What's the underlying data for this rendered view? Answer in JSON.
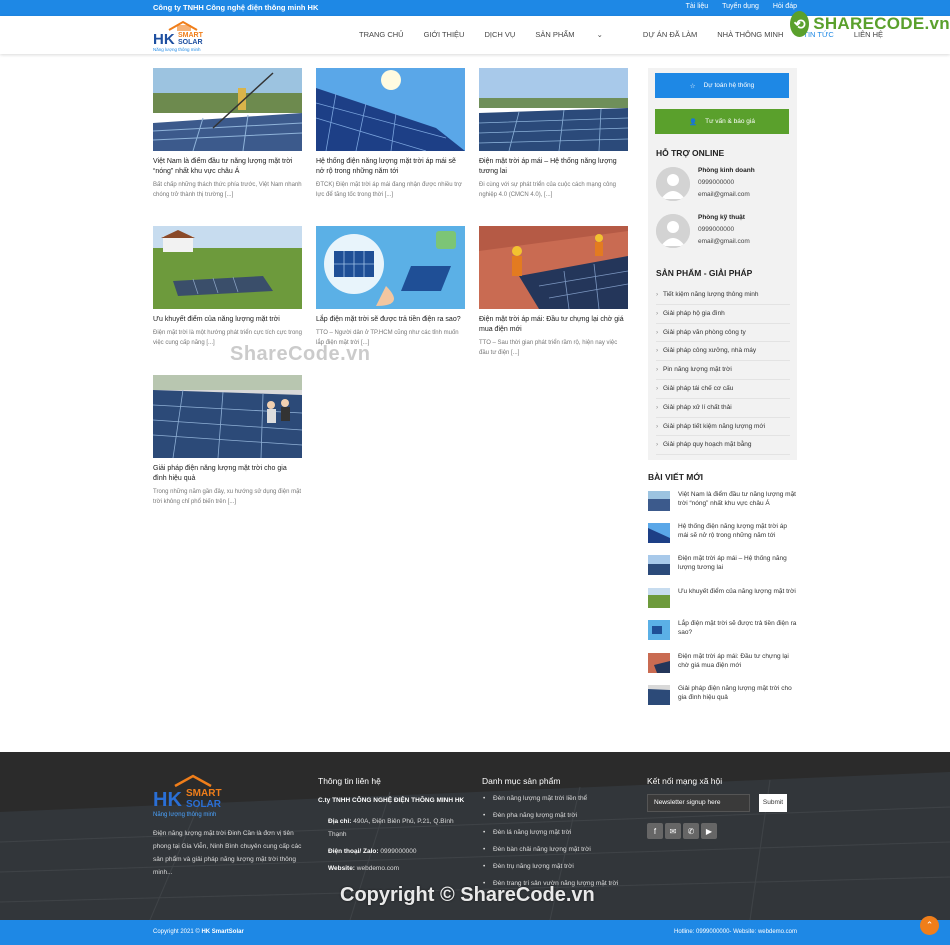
{
  "topbar": {
    "company": "Công ty TNHH Công nghệ điện thông minh HK",
    "links": [
      "Tài liệu",
      "Tuyển dụng",
      "Hỏi đáp"
    ]
  },
  "logo": {
    "main": "HK",
    "sub1": "SMART",
    "sub2": "SOLAR",
    "tagline": "Năng lượng thông minh"
  },
  "nav": [
    "TRANG CHỦ",
    "GIỚI THIỆU",
    "DỊCH VỤ",
    "SẢN PHẨM",
    "DỰ ÁN ĐÃ LÀM",
    "NHÀ THÔNG MINH",
    "TIN TỨC",
    "LIÊN HỆ"
  ],
  "watermark": {
    "logo_text": "SHARECODE.vn",
    "mid": "ShareCode.vn",
    "bottom": "Copyright © ShareCode.vn"
  },
  "posts": [
    {
      "title": "Việt Nam là điểm đầu tư năng lượng mặt trời “nóng” nhất khu vực châu Á",
      "excerpt": "Bất chấp những thách thức phía trước, Việt Nam nhanh chóng trở thành thị trường [...]"
    },
    {
      "title": "Hệ thống điện năng lượng mặt trời áp mái sẽ nở rộ trong những năm tới",
      "excerpt": "ĐTCK) Điện mặt trời áp mái đang nhận được nhiều trợ lực để tăng tốc trong thời [...]"
    },
    {
      "title": "Điện mặt trời áp mái – Hệ thống năng lượng tương lai",
      "excerpt": "Đi cùng với sự phát triển của cuộc cách mạng công nghiệp 4.0 (CMCN 4.0), [...]"
    },
    {
      "title": "Ưu khuyết điểm của năng lượng mặt trời",
      "excerpt": "Điện mặt trời là một hướng phát triển cực tích cực trong việc cung cấp năng [...]"
    },
    {
      "title": "Lắp điện mặt trời sẽ được trả tiền điện ra sao?",
      "excerpt": "TTO – Người dân ở TP.HCM cũng như các tỉnh muốn lắp điện mặt trời [...]"
    },
    {
      "title": "Điện mặt trời áp mái: Đầu tư chựng lại chờ giá mua điện mới",
      "excerpt": "TTO – Sau thời gian phát triển rầm rộ, hiện nay việc đầu tư điện [...]"
    },
    {
      "title": "Giải pháp điện năng lượng mặt trời cho gia đình hiệu quả",
      "excerpt": "Trong những năm gần đây, xu hướng sử dụng điện mặt trời không chỉ phổ biến trên [...]"
    }
  ],
  "sidebar": {
    "btn_estimate": "Dự toán hệ thống",
    "btn_consult": "Tư vấn & báo giá",
    "support_heading": "HỖ TRỢ ONLINE",
    "contacts": [
      {
        "name": "Phòng kinh doanh",
        "phone": "0999000000",
        "email": "email@gmail.com"
      },
      {
        "name": "Phòng kỹ thuật",
        "phone": "0999000000",
        "email": "email@gmail.com"
      }
    ],
    "products_heading": "SẢN PHẨM - GIẢI PHÁP",
    "products": [
      "Tiết kiệm năng lượng thông minh",
      "Giải pháp hộ gia đình",
      "Giải pháp văn phòng công ty",
      "Giải pháp công xưởng, nhà máy",
      "Pin năng lượng mặt trời",
      "Giải pháp tái chế cơ cấu",
      "Giải pháp xử lí chất thải",
      "Giải pháp tiết kiệm năng lượng mới",
      "Giải pháp quy hoạch mặt bằng"
    ],
    "recent_heading": "BÀI VIẾT MỚI",
    "recent": [
      "Việt Nam là điểm đầu tư năng lượng mặt trời “nóng” nhất khu vực châu Á",
      "Hệ thống điện năng lượng mặt trời áp mái sẽ nở rộ trong những năm tới",
      "Điện mặt trời áp mái – Hệ thống năng lượng tương lai",
      "Ưu khuyết điểm của năng lượng mặt trời",
      "Lắp điện mặt trời sẽ được trả tiền điện ra sao?",
      "Điện mặt trời áp mái: Đầu tư chựng lại chờ giá mua điện mới",
      "Giải pháp điện năng lượng mặt trời cho gia đình hiệu quả"
    ]
  },
  "footer": {
    "about": "Điện năng lượng mặt trời Đinh Cần là đơn vị tiên phong tại Gia Viễn, Ninh Bình chuyên cung cấp các sản phẩm và giải pháp năng lượng mặt trời thông minh...",
    "contact_heading": "Thông tin liên hệ",
    "company": "C.ty TNHH CÔNG NGHỆ ĐIỆN THÔNG MINH HK",
    "address_label": "Địa chỉ:",
    "address": "490A, Điện Biên Phủ, P.21, Q.Bình Thạnh",
    "phone_label": "Điện thoại/ Zalo:",
    "phone": "0999000000",
    "website_label": "Website:",
    "website": "webdemo.com",
    "categories_heading": "Danh mục sản phẩm",
    "categories": [
      "Đèn năng lượng mặt trời liền thể",
      "Đèn pha năng lượng mặt trời",
      "Đèn lá năng lượng mặt trời",
      "Đèn bàn chải năng lượng mặt trời",
      "Đèn trụ năng lượng mặt trời",
      "Đèn trang trí sân vườn năng lượng mặt trời"
    ],
    "social_heading": "Kết nối mạng xã hội",
    "newsletter_placeholder": "Newsletter signup here",
    "submit": "Submit",
    "copyright_prefix": "Copyright 2021 ©",
    "copyright_brand": "HK SmartSolar",
    "hotline": "Hotline: 0999000000- Website: webdemo.com"
  },
  "colors": {
    "primary": "#1e88e5",
    "green": "#5aa02c",
    "orange": "#f07e1a"
  }
}
